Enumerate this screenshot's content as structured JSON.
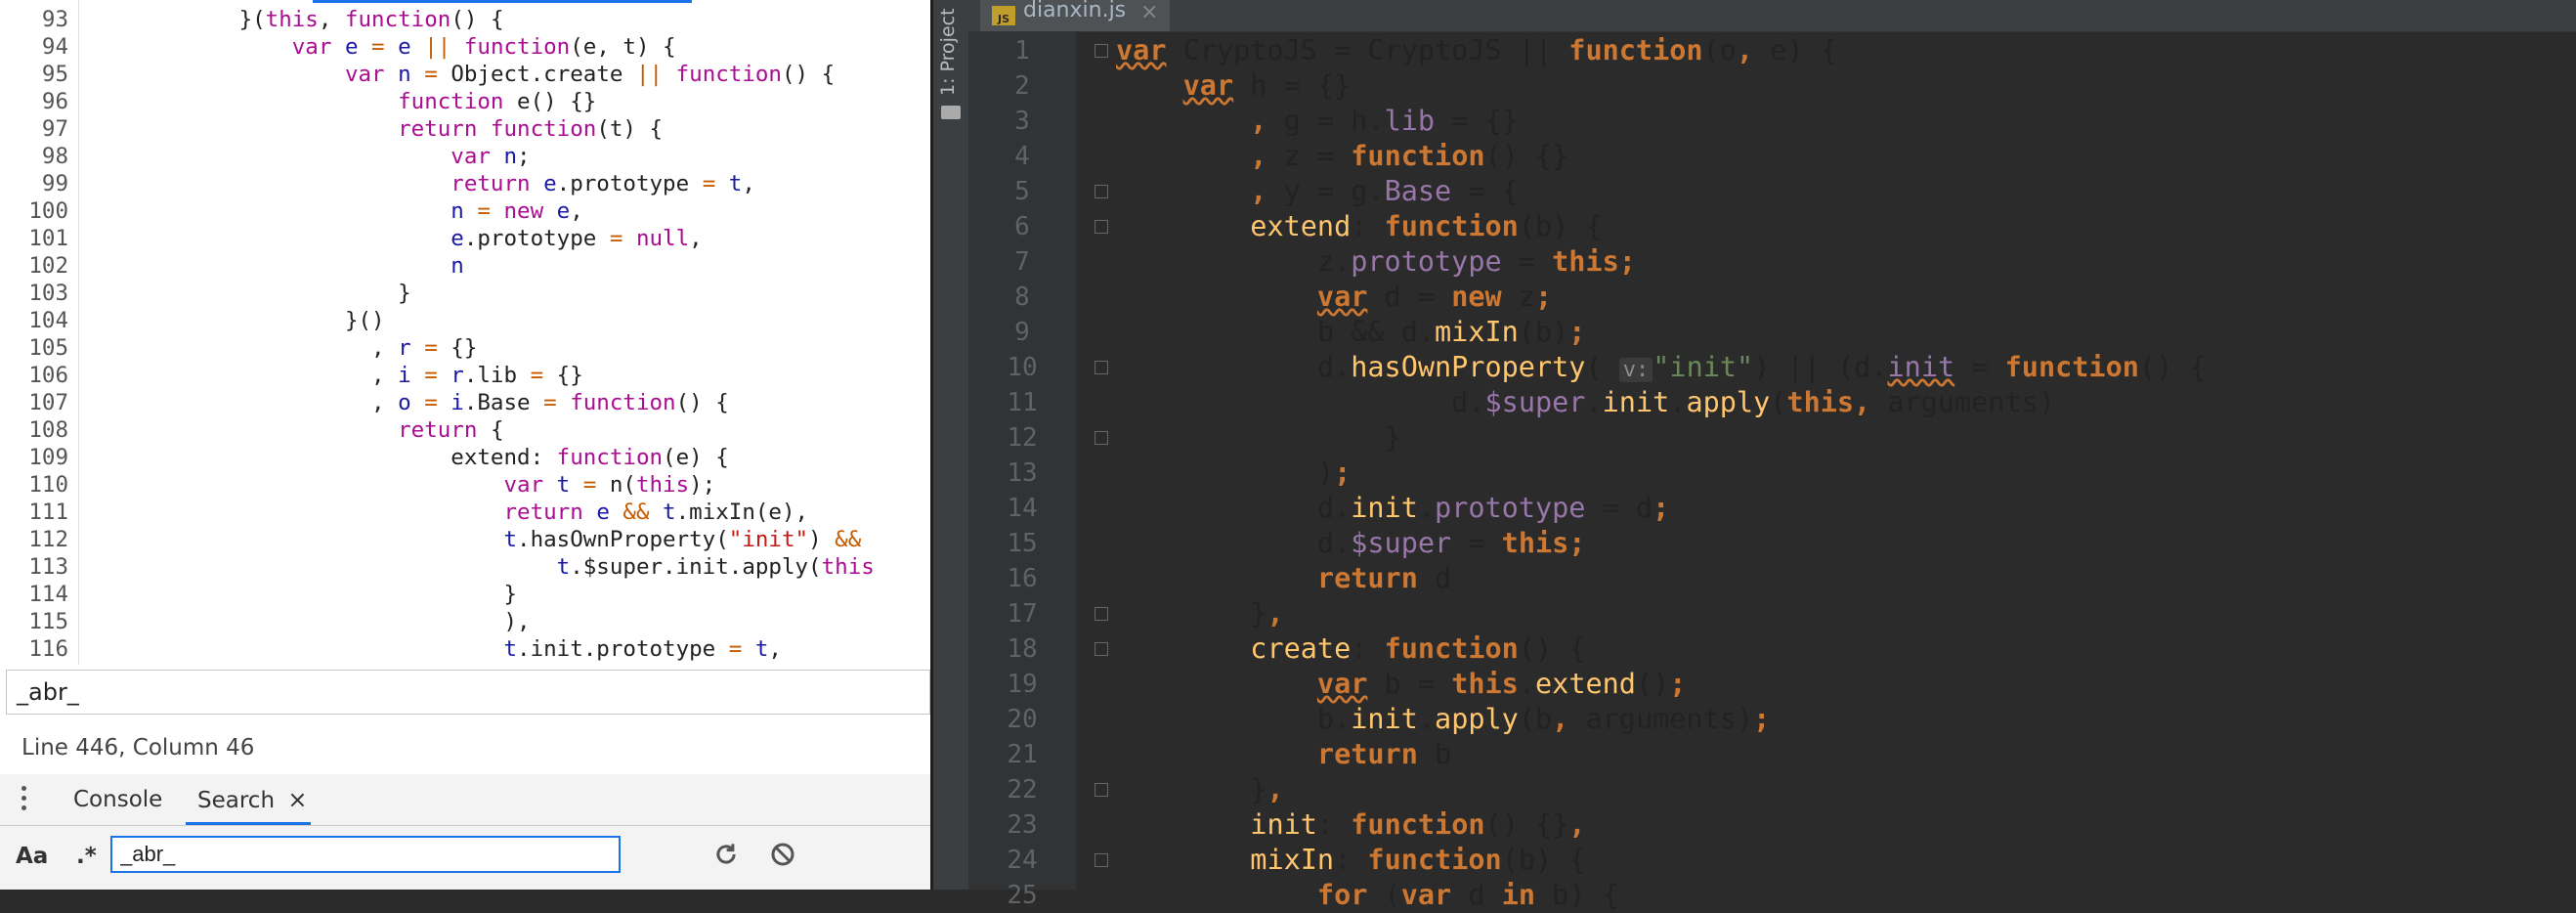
{
  "left_pane": {
    "code_lines": [
      {
        "num": "93",
        "indent": "            ",
        "tokens": [
          [
            "pl",
            "}("
          ],
          [
            "kw",
            "this"
          ],
          [
            "pl",
            ", "
          ],
          [
            "kw",
            "function"
          ],
          [
            "pl",
            "() {"
          ]
        ]
      },
      {
        "num": "94",
        "indent": "                ",
        "tokens": [
          [
            "kw",
            "var "
          ],
          [
            "vr",
            "e"
          ],
          [
            "op",
            " = "
          ],
          [
            "vr",
            "e"
          ],
          [
            "op",
            " || "
          ],
          [
            "kw",
            "function"
          ],
          [
            "pl",
            "(e, t) {"
          ]
        ]
      },
      {
        "num": "95",
        "indent": "                    ",
        "tokens": [
          [
            "kw",
            "var "
          ],
          [
            "vr",
            "n"
          ],
          [
            "op",
            " = "
          ],
          [
            "pl",
            "Object.create "
          ],
          [
            "op",
            "|| "
          ],
          [
            "kw",
            "function"
          ],
          [
            "pl",
            "() {"
          ]
        ]
      },
      {
        "num": "96",
        "indent": "                        ",
        "tokens": [
          [
            "kw",
            "function "
          ],
          [
            "pl",
            "e() {}"
          ]
        ]
      },
      {
        "num": "97",
        "indent": "                        ",
        "tokens": [
          [
            "kw",
            "return function"
          ],
          [
            "pl",
            "(t) {"
          ]
        ]
      },
      {
        "num": "98",
        "indent": "                            ",
        "tokens": [
          [
            "kw",
            "var "
          ],
          [
            "vr",
            "n"
          ],
          [
            "pl",
            ";"
          ]
        ]
      },
      {
        "num": "99",
        "indent": "                            ",
        "tokens": [
          [
            "kw",
            "return "
          ],
          [
            "vr",
            "e"
          ],
          [
            "pl",
            ".prototype "
          ],
          [
            "op",
            "= "
          ],
          [
            "vr",
            "t"
          ],
          [
            "pl",
            ","
          ]
        ]
      },
      {
        "num": "100",
        "indent": "                            ",
        "tokens": [
          [
            "vr",
            "n"
          ],
          [
            "op",
            " = "
          ],
          [
            "kw",
            "new "
          ],
          [
            "vr",
            "e"
          ],
          [
            "pl",
            ","
          ]
        ]
      },
      {
        "num": "101",
        "indent": "                            ",
        "tokens": [
          [
            "vr",
            "e"
          ],
          [
            "pl",
            ".prototype "
          ],
          [
            "op",
            "= "
          ],
          [
            "kw",
            "null"
          ],
          [
            "pl",
            ","
          ]
        ]
      },
      {
        "num": "102",
        "indent": "                            ",
        "tokens": [
          [
            "vr",
            "n"
          ]
        ]
      },
      {
        "num": "103",
        "indent": "                        ",
        "tokens": [
          [
            "pl",
            "}"
          ]
        ]
      },
      {
        "num": "104",
        "indent": "                    ",
        "tokens": [
          [
            "pl",
            "}()"
          ]
        ]
      },
      {
        "num": "105",
        "indent": "                      ",
        "tokens": [
          [
            "pl",
            ", "
          ],
          [
            "vr",
            "r"
          ],
          [
            "op",
            " = "
          ],
          [
            "pl",
            "{}"
          ]
        ]
      },
      {
        "num": "106",
        "indent": "                      ",
        "tokens": [
          [
            "pl",
            ", "
          ],
          [
            "vr",
            "i"
          ],
          [
            "op",
            " = "
          ],
          [
            "vr",
            "r"
          ],
          [
            "pl",
            ".lib "
          ],
          [
            "op",
            "= "
          ],
          [
            "pl",
            "{}"
          ]
        ]
      },
      {
        "num": "107",
        "indent": "                      ",
        "tokens": [
          [
            "pl",
            ", "
          ],
          [
            "vr",
            "o"
          ],
          [
            "op",
            " = "
          ],
          [
            "vr",
            "i"
          ],
          [
            "pl",
            ".Base "
          ],
          [
            "op",
            "= "
          ],
          [
            "kw",
            "function"
          ],
          [
            "pl",
            "() {"
          ]
        ]
      },
      {
        "num": "108",
        "indent": "                        ",
        "tokens": [
          [
            "kw",
            "return "
          ],
          [
            "pl",
            "{"
          ]
        ]
      },
      {
        "num": "109",
        "indent": "                            ",
        "tokens": [
          [
            "pl",
            "extend: "
          ],
          [
            "kw",
            "function"
          ],
          [
            "pl",
            "(e) {"
          ]
        ]
      },
      {
        "num": "110",
        "indent": "                                ",
        "tokens": [
          [
            "kw",
            "var "
          ],
          [
            "vr",
            "t"
          ],
          [
            "op",
            " = "
          ],
          [
            "pl",
            "n("
          ],
          [
            "kw",
            "this"
          ],
          [
            "pl",
            ");"
          ]
        ]
      },
      {
        "num": "111",
        "indent": "                                ",
        "tokens": [
          [
            "kw",
            "return "
          ],
          [
            "vr",
            "e"
          ],
          [
            "op",
            " && "
          ],
          [
            "vr",
            "t"
          ],
          [
            "pl",
            ".mixIn(e),"
          ]
        ]
      },
      {
        "num": "112",
        "indent": "                                ",
        "tokens": [
          [
            "vr",
            "t"
          ],
          [
            "pl",
            ".hasOwnProperty("
          ],
          [
            "st",
            "\"init\""
          ],
          [
            "pl",
            ") "
          ],
          [
            "op",
            "&&"
          ]
        ]
      },
      {
        "num": "113",
        "indent": "                                    ",
        "tokens": [
          [
            "vr",
            "t"
          ],
          [
            "pl",
            ".$super.init.apply("
          ],
          [
            "kw",
            "this"
          ]
        ]
      },
      {
        "num": "114",
        "indent": "                                ",
        "tokens": [
          [
            "pl",
            "}"
          ]
        ]
      },
      {
        "num": "115",
        "indent": "                                ",
        "tokens": [
          [
            "pl",
            "),"
          ]
        ]
      },
      {
        "num": "116",
        "indent": "                                ",
        "tokens": [
          [
            "vr",
            "t"
          ],
          [
            "pl",
            ".init.prototype "
          ],
          [
            "op",
            "= "
          ],
          [
            "vr",
            "t"
          ],
          [
            "pl",
            ","
          ]
        ]
      }
    ],
    "find_value": "_abr_",
    "status_text": "Line 446, Column 46",
    "tabs": {
      "console": "Console",
      "search": "Search",
      "search_close": "×"
    },
    "search": {
      "case_label": "Aa",
      "regex_label": ".*",
      "query": "_abr_"
    }
  },
  "right_pane": {
    "project_label": "1: Project",
    "file_tab": {
      "icon": "JS",
      "name": "dianxin.js",
      "close": "×"
    },
    "code_lines": [
      {
        "num": "1",
        "fold": "open",
        "tokens": [
          [
            "ik iw",
            "var"
          ],
          [
            "pl",
            " CryptoJS = CryptoJS || "
          ],
          [
            "ik",
            "function"
          ],
          [
            "pl",
            "(o"
          ],
          [
            "ik",
            ","
          ],
          [
            "pl",
            " e) {"
          ]
        ]
      },
      {
        "num": "2",
        "fold": "",
        "tokens": [
          [
            "pl",
            "    "
          ],
          [
            "ik iw",
            "var"
          ],
          [
            "pl",
            " h = {}"
          ]
        ]
      },
      {
        "num": "3",
        "fold": "",
        "tokens": [
          [
            "pl",
            "        "
          ],
          [
            "ik",
            ","
          ],
          [
            "pl",
            " g = h."
          ],
          [
            "ip",
            "lib"
          ],
          [
            "pl",
            " = {}"
          ]
        ]
      },
      {
        "num": "4",
        "fold": "",
        "tokens": [
          [
            "pl",
            "        "
          ],
          [
            "ik",
            ","
          ],
          [
            "pl",
            " z = "
          ],
          [
            "ik",
            "function"
          ],
          [
            "pl",
            "() {}"
          ]
        ]
      },
      {
        "num": "5",
        "fold": "open",
        "tokens": [
          [
            "pl",
            "        "
          ],
          [
            "ik",
            ","
          ],
          [
            "pl",
            " y = g."
          ],
          [
            "ip",
            "Base"
          ],
          [
            "pl",
            " = {"
          ]
        ]
      },
      {
        "num": "6",
        "fold": "open",
        "tokens": [
          [
            "pl",
            "        "
          ],
          [
            "ifn",
            "extend"
          ],
          [
            "pl",
            ": "
          ],
          [
            "ik",
            "function"
          ],
          [
            "pl",
            "(b) {"
          ]
        ]
      },
      {
        "num": "7",
        "fold": "",
        "tokens": [
          [
            "pl",
            "            z."
          ],
          [
            "ip",
            "prototype"
          ],
          [
            "pl",
            " = "
          ],
          [
            "ik",
            "this;"
          ]
        ]
      },
      {
        "num": "8",
        "fold": "",
        "tokens": [
          [
            "pl",
            "            "
          ],
          [
            "ik iw",
            "var"
          ],
          [
            "pl",
            " d = "
          ],
          [
            "ik",
            "new"
          ],
          [
            "pl",
            " z"
          ],
          [
            "ik",
            ";"
          ]
        ]
      },
      {
        "num": "9",
        "fold": "",
        "tokens": [
          [
            "pl",
            "            b && d."
          ],
          [
            "ifn",
            "mixIn"
          ],
          [
            "pl",
            "(b)"
          ],
          [
            "ik",
            ";"
          ]
        ]
      },
      {
        "num": "10",
        "fold": "open",
        "tokens": [
          [
            "pl",
            "            d."
          ],
          [
            "ifn",
            "hasOwnProperty"
          ],
          [
            "pl",
            "( "
          ],
          [
            "hint",
            "v:"
          ],
          [
            "is",
            "\"init\""
          ],
          [
            "pl",
            ") || (d."
          ],
          [
            "ip iw",
            "init"
          ],
          [
            "pl",
            " = "
          ],
          [
            "ik",
            "function"
          ],
          [
            "pl",
            "() {"
          ]
        ]
      },
      {
        "num": "11",
        "fold": "",
        "tokens": [
          [
            "pl",
            "                    d."
          ],
          [
            "ip",
            "$super"
          ],
          [
            "pl",
            "."
          ],
          [
            "ifn",
            "init"
          ],
          [
            "pl",
            "."
          ],
          [
            "ifn",
            "apply"
          ],
          [
            "pl",
            "("
          ],
          [
            "ik",
            "this,"
          ],
          [
            "pl",
            " arguments)"
          ]
        ]
      },
      {
        "num": "12",
        "fold": "close",
        "tokens": [
          [
            "pl",
            "                }"
          ]
        ]
      },
      {
        "num": "13",
        "fold": "",
        "tokens": [
          [
            "pl",
            "            )"
          ],
          [
            "ik",
            ";"
          ]
        ]
      },
      {
        "num": "14",
        "fold": "",
        "tokens": [
          [
            "pl",
            "            d."
          ],
          [
            "ifn",
            "init"
          ],
          [
            "pl",
            "."
          ],
          [
            "ip",
            "prototype"
          ],
          [
            "pl",
            " = d"
          ],
          [
            "ik",
            ";"
          ]
        ]
      },
      {
        "num": "15",
        "fold": "",
        "tokens": [
          [
            "pl",
            "            d."
          ],
          [
            "ip",
            "$super"
          ],
          [
            "pl",
            " = "
          ],
          [
            "ik",
            "this;"
          ]
        ]
      },
      {
        "num": "16",
        "fold": "",
        "tokens": [
          [
            "pl",
            "            "
          ],
          [
            "ik",
            "return"
          ],
          [
            "pl",
            " d"
          ]
        ]
      },
      {
        "num": "17",
        "fold": "close",
        "tokens": [
          [
            "pl",
            "        }"
          ],
          [
            "ik",
            ","
          ]
        ]
      },
      {
        "num": "18",
        "fold": "open",
        "tokens": [
          [
            "pl",
            "        "
          ],
          [
            "ifn",
            "create"
          ],
          [
            "pl",
            ": "
          ],
          [
            "ik",
            "function"
          ],
          [
            "pl",
            "() {"
          ]
        ]
      },
      {
        "num": "19",
        "fold": "",
        "tokens": [
          [
            "pl",
            "            "
          ],
          [
            "ik iw",
            "var"
          ],
          [
            "pl",
            " b = "
          ],
          [
            "ik",
            "this"
          ],
          [
            "pl",
            "."
          ],
          [
            "ifn",
            "extend"
          ],
          [
            "pl",
            "()"
          ],
          [
            "ik",
            ";"
          ]
        ]
      },
      {
        "num": "20",
        "fold": "",
        "tokens": [
          [
            "pl",
            "            b."
          ],
          [
            "ifn",
            "init"
          ],
          [
            "pl",
            "."
          ],
          [
            "ifn",
            "apply"
          ],
          [
            "pl",
            "(b"
          ],
          [
            "ik",
            ","
          ],
          [
            "pl",
            " arguments)"
          ],
          [
            "ik",
            ";"
          ]
        ]
      },
      {
        "num": "21",
        "fold": "",
        "tokens": [
          [
            "pl",
            "            "
          ],
          [
            "ik",
            "return"
          ],
          [
            "pl",
            " b"
          ]
        ]
      },
      {
        "num": "22",
        "fold": "close",
        "tokens": [
          [
            "pl",
            "        }"
          ],
          [
            "ik",
            ","
          ]
        ]
      },
      {
        "num": "23",
        "fold": "",
        "tokens": [
          [
            "pl",
            "        "
          ],
          [
            "ifn",
            "init"
          ],
          [
            "pl",
            ": "
          ],
          [
            "ik",
            "function"
          ],
          [
            "pl",
            "() {}"
          ],
          [
            "ik",
            ","
          ]
        ]
      },
      {
        "num": "24",
        "fold": "open",
        "tokens": [
          [
            "pl",
            "        "
          ],
          [
            "ifn",
            "mixIn"
          ],
          [
            "pl",
            ": "
          ],
          [
            "ik",
            "function"
          ],
          [
            "pl",
            "(b) {"
          ]
        ]
      },
      {
        "num": "25",
        "fold": "",
        "tokens": [
          [
            "pl",
            "            "
          ],
          [
            "ik",
            "for"
          ],
          [
            "pl",
            " ("
          ],
          [
            "ik",
            "var"
          ],
          [
            "pl",
            " d "
          ],
          [
            "ik",
            "in"
          ],
          [
            "pl",
            " b) {"
          ]
        ]
      }
    ]
  }
}
